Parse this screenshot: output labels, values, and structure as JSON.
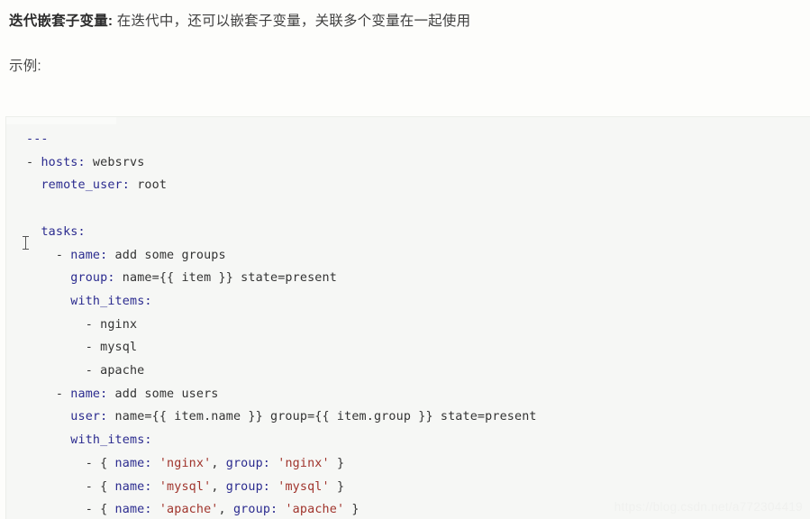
{
  "document": {
    "paragraphs": [
      {
        "lead": "迭代嵌套子变量:",
        "rest": " 在迭代中，还可以嵌套子变量，关联多个变量在一起使用"
      },
      {
        "text": "示例:"
      }
    ]
  },
  "code_block": {
    "language": "yaml",
    "lines": [
      {
        "tokens": [
          {
            "text": "---",
            "type": "k"
          }
        ]
      },
      {
        "tokens": [
          {
            "text": "- ",
            "type": "t"
          },
          {
            "text": "hosts:",
            "type": "k"
          },
          {
            "text": " websrvs",
            "type": "t"
          }
        ]
      },
      {
        "tokens": [
          {
            "text": "  ",
            "type": "t"
          },
          {
            "text": "remote_user:",
            "type": "k"
          },
          {
            "text": " root",
            "type": "t"
          }
        ]
      },
      {
        "tokens": []
      },
      {
        "tokens": [
          {
            "text": "  ",
            "type": "t"
          },
          {
            "text": "tasks:",
            "type": "k"
          }
        ]
      },
      {
        "tokens": [
          {
            "text": "    - ",
            "type": "t"
          },
          {
            "text": "name:",
            "type": "k"
          },
          {
            "text": " add some groups",
            "type": "t"
          }
        ]
      },
      {
        "tokens": [
          {
            "text": "      ",
            "type": "t"
          },
          {
            "text": "group:",
            "type": "k"
          },
          {
            "text": " name={{ item }} state=present",
            "type": "t"
          }
        ]
      },
      {
        "tokens": [
          {
            "text": "      ",
            "type": "t"
          },
          {
            "text": "with_items:",
            "type": "k"
          }
        ]
      },
      {
        "tokens": [
          {
            "text": "        - nginx",
            "type": "t"
          }
        ]
      },
      {
        "tokens": [
          {
            "text": "        - mysql",
            "type": "t"
          }
        ]
      },
      {
        "tokens": [
          {
            "text": "        - apache",
            "type": "t"
          }
        ]
      },
      {
        "tokens": [
          {
            "text": "    - ",
            "type": "t"
          },
          {
            "text": "name:",
            "type": "k"
          },
          {
            "text": " add some users",
            "type": "t"
          }
        ]
      },
      {
        "tokens": [
          {
            "text": "      ",
            "type": "t"
          },
          {
            "text": "user:",
            "type": "k"
          },
          {
            "text": " name={{ item.name }} group={{ item.group }} state=present",
            "type": "t"
          }
        ]
      },
      {
        "tokens": [
          {
            "text": "      ",
            "type": "t"
          },
          {
            "text": "with_items:",
            "type": "k"
          }
        ]
      },
      {
        "tokens": [
          {
            "text": "        - { ",
            "type": "t"
          },
          {
            "text": "name:",
            "type": "k"
          },
          {
            "text": " ",
            "type": "t"
          },
          {
            "text": "'nginx'",
            "type": "s"
          },
          {
            "text": ", ",
            "type": "t"
          },
          {
            "text": "group:",
            "type": "k"
          },
          {
            "text": " ",
            "type": "t"
          },
          {
            "text": "'nginx'",
            "type": "s"
          },
          {
            "text": " }",
            "type": "t"
          }
        ]
      },
      {
        "tokens": [
          {
            "text": "        - { ",
            "type": "t"
          },
          {
            "text": "name:",
            "type": "k"
          },
          {
            "text": " ",
            "type": "t"
          },
          {
            "text": "'mysql'",
            "type": "s"
          },
          {
            "text": ", ",
            "type": "t"
          },
          {
            "text": "group:",
            "type": "k"
          },
          {
            "text": " ",
            "type": "t"
          },
          {
            "text": "'mysql'",
            "type": "s"
          },
          {
            "text": " }",
            "type": "t"
          }
        ]
      },
      {
        "tokens": [
          {
            "text": "        - { ",
            "type": "t"
          },
          {
            "text": "name:",
            "type": "k"
          },
          {
            "text": " ",
            "type": "t"
          },
          {
            "text": "'apache'",
            "type": "s"
          },
          {
            "text": ", ",
            "type": "t"
          },
          {
            "text": "group:",
            "type": "k"
          },
          {
            "text": " ",
            "type": "t"
          },
          {
            "text": "'apache'",
            "type": "s"
          },
          {
            "text": " }",
            "type": "t"
          }
        ]
      }
    ]
  },
  "watermark": {
    "text": "https://blog.csdn.net/a772304419"
  },
  "colors": {
    "page_background": "#fdfdfb",
    "code_background": "#f6f7f5",
    "key_token": "#2b2b8f",
    "string_token": "#a0342c",
    "plain_token": "#333333",
    "body_text": "#3f3f3f",
    "watermark": "#f0f1ef"
  }
}
